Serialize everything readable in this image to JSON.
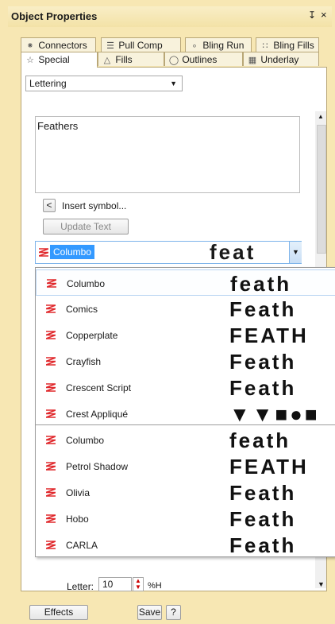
{
  "window": {
    "title": "Object Properties",
    "pin_glyph": "↧",
    "close_glyph": "×"
  },
  "tabs_row1": [
    {
      "label": "Connectors",
      "icon": "connectors-icon"
    },
    {
      "label": "Pull Comp",
      "icon": "pull-comp-icon"
    },
    {
      "label": "Bling Run",
      "icon": "bling-run-icon"
    },
    {
      "label": "Bling Fills",
      "icon": "bling-fills-icon"
    }
  ],
  "tabs_row2": [
    {
      "label": "Special",
      "icon": "star-icon",
      "active": true
    },
    {
      "label": "Fills",
      "icon": "fills-icon"
    },
    {
      "label": "Outlines",
      "icon": "outlines-icon"
    },
    {
      "label": "Underlay",
      "icon": "underlay-icon"
    }
  ],
  "type_select": {
    "value": "Lettering"
  },
  "text_value": "Feathers",
  "insert_symbol": {
    "button": "<",
    "label": "Insert symbol..."
  },
  "update_text": "Update Text",
  "font_combo": {
    "selected": "Columbo",
    "preview": "feat"
  },
  "font_list": {
    "recent": [
      {
        "name": "Columbo",
        "preview": "feath"
      },
      {
        "name": "Comics",
        "preview": "Feath"
      },
      {
        "name": "Copperplate",
        "preview": "FEATH"
      },
      {
        "name": "Crayfish",
        "preview": "Feath"
      },
      {
        "name": "Crescent Script",
        "preview": "Feath"
      },
      {
        "name": "Crest Appliqué",
        "preview": "▼▼■●■"
      }
    ],
    "all": [
      {
        "name": "Columbo",
        "preview": "feath"
      },
      {
        "name": "Petrol Shadow",
        "preview": "FEATH"
      },
      {
        "name": "Olivia",
        "preview": "Feath"
      },
      {
        "name": "Hobo",
        "preview": "Feath"
      },
      {
        "name": "CARLA",
        "preview": "Feath"
      }
    ]
  },
  "letter": {
    "label": "Letter:",
    "value": "10",
    "unit": "%H"
  },
  "buttons": {
    "effects": "Effects",
    "save": "Save",
    "help": "?"
  },
  "colors": {
    "accent": "#3399ff",
    "font_icon": "#e0282c",
    "panel_bg": "#f7e7b3"
  }
}
